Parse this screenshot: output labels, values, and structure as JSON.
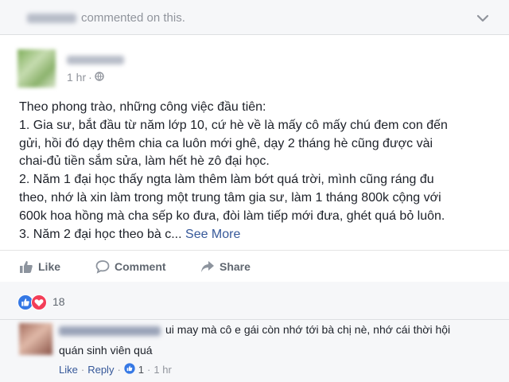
{
  "header": {
    "action_text": "commented on this."
  },
  "post": {
    "time": "1 hr",
    "lines": [
      "Theo phong trào, những công việc đầu tiên:",
      "1. Gia sư, bắt đầu từ năm lớp 10, cứ hè về là mấy cô mấy chú đem con đến",
      "gửi, hồi đó dạy thêm chia ca luôn mới ghê, dạy 2 tháng hè cũng được vài",
      "chai-đủ tiền sắm sửa, làm hết hè zô đại học.",
      "2. Năm 1 đại học thấy ngta làm thêm làm bớt quá trời, mình cũng ráng đu",
      "theo, nhớ là xin làm trong một trung tâm gia sư, làm 1 tháng 800k cộng với",
      "600k hoa hồng mà cha sếp ko đưa, đòi làm tiếp mới đưa, ghét quá bỏ luôn.",
      "3. Năm 2 đại học theo bà c..."
    ],
    "see_more": "See More"
  },
  "actions": {
    "like": "Like",
    "comment": "Comment",
    "share": "Share"
  },
  "reactions": {
    "count": "18",
    "icons": [
      "like-icon",
      "love-icon"
    ]
  },
  "comment": {
    "text_line1": "ui may mà cô e gái còn nhớ tới bà chị nè, nhớ cái thời hội",
    "text_line2": "quán sinh viên quá",
    "like": "Like",
    "reply": "Reply",
    "like_count": "1",
    "time": "1 hr",
    "separator": "·"
  },
  "colors": {
    "link": "#365899",
    "meta": "#90949c",
    "like_blue": "#3578e5",
    "love_red": "#f33e58"
  }
}
